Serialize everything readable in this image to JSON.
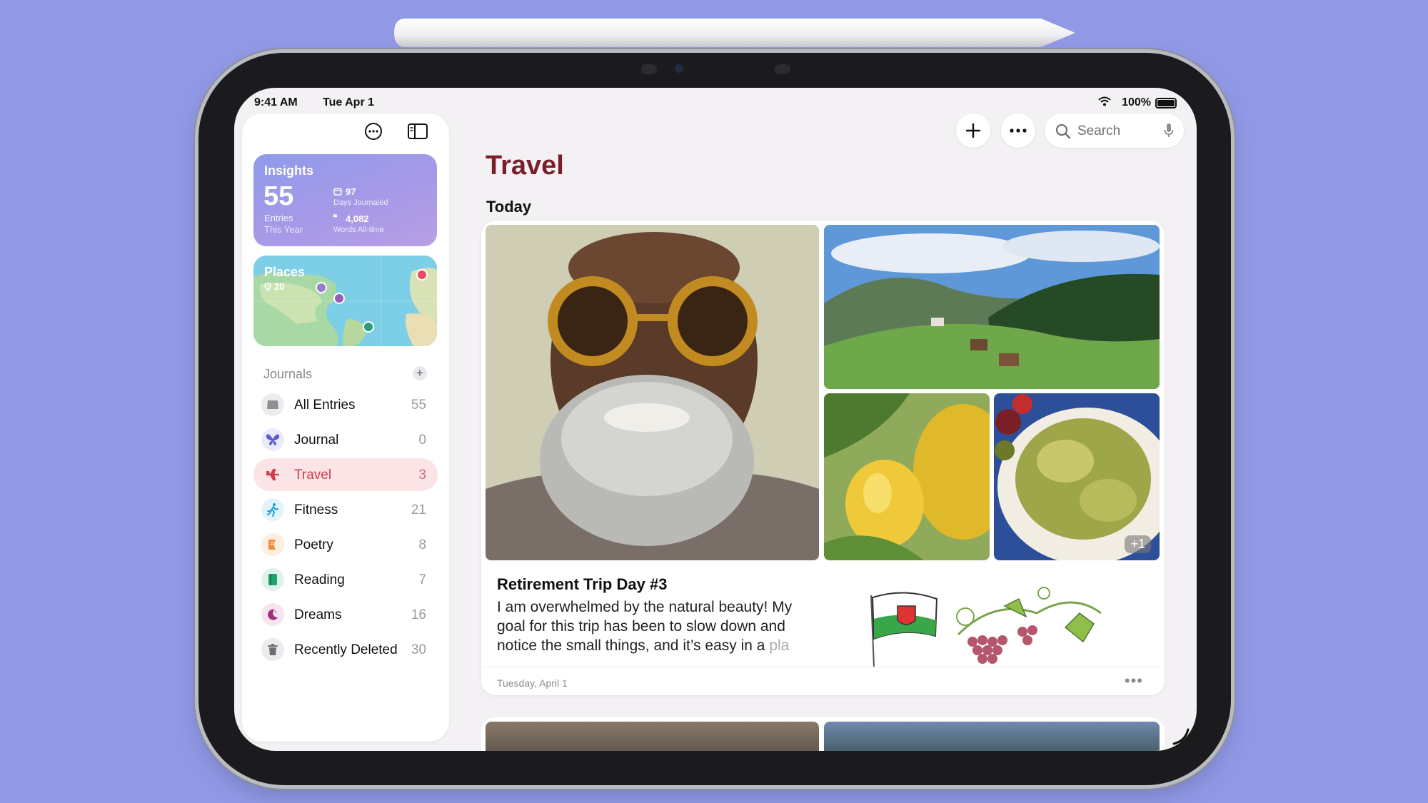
{
  "status_bar": {
    "time": "9:41 AM",
    "date": "Tue Apr 1",
    "battery": "100%"
  },
  "sidebar": {
    "insights": {
      "title": "Insights",
      "entries_count": "55",
      "entries_label_1": "Entries",
      "entries_label_2": "This Year",
      "days_value": "97",
      "days_label": "Days Journaled",
      "words_value": "4,082",
      "words_label": "Words All-time"
    },
    "places": {
      "title": "Places",
      "count": "20"
    },
    "journals_header": "Journals",
    "journals": [
      {
        "label": "All Entries",
        "count": "55",
        "icon": "tray-icon",
        "color": "#8e8e93"
      },
      {
        "label": "Journal",
        "count": "0",
        "icon": "butterfly-icon",
        "color": "#5b5bd6"
      },
      {
        "label": "Travel",
        "count": "3",
        "icon": "airplane-icon",
        "color": "#d23a4a"
      },
      {
        "label": "Fitness",
        "count": "21",
        "icon": "figure-run-icon",
        "color": "#1e9fd8"
      },
      {
        "label": "Poetry",
        "count": "8",
        "icon": "quill-icon",
        "color": "#f08a3c"
      },
      {
        "label": "Reading",
        "count": "7",
        "icon": "book-icon",
        "color": "#1ea36b"
      },
      {
        "label": "Dreams",
        "count": "16",
        "icon": "moon-icon",
        "color": "#a0307a"
      },
      {
        "label": "Recently Deleted",
        "count": "30",
        "icon": "trash-icon",
        "color": "#6e6e73"
      }
    ]
  },
  "toolbar": {
    "search_placeholder": "Search"
  },
  "main": {
    "title": "Travel",
    "section": "Today",
    "entry": {
      "title": "Retirement Trip Day #3",
      "body": "I am overwhelmed by the natural beauty! My goal for this trip has been to slow down and notice the small things, and it’s easy in a ",
      "body_fade": "pla",
      "date": "Tuesday, April 1",
      "extra_photos": "+1"
    }
  },
  "colors": {
    "accent": "#d23a4a",
    "title": "#7a1f2a",
    "background": "#9199e6"
  }
}
